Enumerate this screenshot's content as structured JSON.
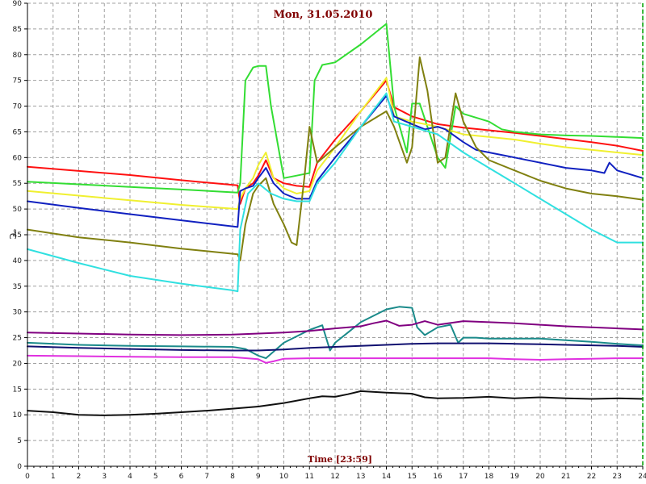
{
  "chart_data": {
    "type": "line",
    "title": "Mon, 31.05.2010",
    "xlabel": "Time [23:59]",
    "ylabel": "°C",
    "xlim": [
      0,
      24
    ],
    "ylim": [
      0,
      90
    ],
    "x_ticks": [
      0,
      1,
      2,
      3,
      4,
      5,
      6,
      7,
      8,
      9,
      10,
      11,
      12,
      13,
      14,
      15,
      16,
      17,
      18,
      19,
      20,
      21,
      22,
      23,
      24
    ],
    "y_ticks": [
      0,
      5,
      10,
      15,
      20,
      25,
      30,
      35,
      40,
      45,
      50,
      55,
      60,
      65,
      70,
      75,
      80,
      85,
      90
    ],
    "grid": true,
    "colors": {
      "grid": "#a0a0a0",
      "title": "#800000",
      "axis_frame_right": "#00a000"
    },
    "series": [
      {
        "color": "#ff1010",
        "x": [
          0,
          2,
          4,
          6,
          8.2,
          8.3,
          8.5,
          8.8,
          9,
          9.3,
          9.6,
          10,
          10.5,
          11,
          11.3,
          12,
          13,
          14,
          14.3,
          15,
          16,
          17,
          18,
          19,
          20,
          21,
          22,
          23,
          24
        ],
        "y": [
          58.2,
          57.4,
          56.6,
          55.6,
          54.6,
          51,
          54,
          55,
          56.5,
          59.5,
          56,
          55,
          54.5,
          54.3,
          59,
          63.5,
          69,
          75,
          69.8,
          68,
          66.5,
          65.8,
          65.3,
          64.8,
          64.2,
          63.6,
          63,
          62.3,
          61.3
        ]
      },
      {
        "color": "#33dd33",
        "x": [
          0,
          2,
          4,
          6,
          8.2,
          8.3,
          8.5,
          8.8,
          9,
          9.3,
          9.5,
          10,
          10.5,
          11,
          11.2,
          11.5,
          12,
          13,
          14,
          14.3,
          14.8,
          15,
          15.3,
          15.6,
          16,
          16.3,
          16.7,
          17,
          18,
          18.5,
          19,
          20,
          21,
          22,
          23,
          24
        ],
        "y": [
          55.3,
          54.8,
          54.3,
          53.8,
          53.2,
          55,
          75,
          77.5,
          77.8,
          77.8,
          70,
          56,
          56.5,
          57,
          75,
          78,
          78.5,
          82,
          86,
          70,
          61,
          70.5,
          70.5,
          66,
          60,
          58,
          70,
          68.5,
          67,
          65.5,
          65,
          64.5,
          64.3,
          64.2,
          64,
          63.8
        ]
      },
      {
        "color": "#f0f030",
        "x": [
          0,
          2,
          4,
          6,
          8.2,
          8.3,
          8.5,
          8.8,
          9,
          9.3,
          9.6,
          10,
          10.5,
          11,
          11.3,
          12,
          13,
          14,
          14.3,
          15,
          16,
          17,
          18,
          19,
          20,
          21,
          22,
          23,
          24
        ],
        "y": [
          53.5,
          52.6,
          51.7,
          50.8,
          50,
          52,
          54,
          56,
          58.5,
          61,
          56,
          54,
          53,
          53.5,
          57.5,
          62,
          69,
          75.5,
          68,
          67,
          66,
          64.5,
          64,
          63.5,
          62.7,
          62,
          61.5,
          61,
          60.5
        ]
      },
      {
        "color": "#1020c0",
        "x": [
          0,
          2,
          4,
          6,
          8.2,
          8.3,
          8.5,
          8.8,
          9,
          9.3,
          9.6,
          10,
          10.5,
          11,
          11.3,
          12,
          13,
          14,
          14.3,
          15,
          15.5,
          16,
          16.3,
          17,
          17.5,
          18,
          19,
          20,
          21,
          22,
          22.5,
          22.7,
          23,
          24
        ],
        "y": [
          51.5,
          50.2,
          49,
          47.8,
          46.5,
          53.5,
          54,
          54.5,
          56,
          58,
          55,
          53,
          52,
          52,
          55.5,
          60,
          66,
          72,
          68,
          66.5,
          65.5,
          66,
          65.5,
          63,
          61.5,
          61,
          60,
          59,
          58,
          57.5,
          57,
          59,
          57.5,
          56
        ]
      },
      {
        "color": "#808010",
        "x": [
          0,
          2,
          4,
          6,
          8.2,
          8.3,
          8.5,
          8.8,
          9,
          9.3,
          9.6,
          10,
          10.3,
          10.5,
          10.8,
          11,
          11.3,
          12,
          13,
          14,
          14.3,
          14.8,
          15,
          15.3,
          15.6,
          16,
          16.3,
          16.7,
          17,
          17.5,
          18,
          19,
          20,
          21,
          22,
          23,
          24
        ],
        "y": [
          46,
          44.5,
          43.5,
          42.3,
          41.2,
          40,
          47,
          53,
          54.5,
          56,
          51,
          47,
          43.5,
          43,
          56,
          66,
          59,
          62,
          66,
          69,
          66,
          59,
          62,
          79.5,
          73,
          59,
          60,
          72.5,
          67,
          62,
          59.5,
          57.5,
          55.5,
          54,
          53,
          52.5,
          51.8
        ]
      },
      {
        "color": "#30e0e0",
        "x": [
          0,
          2,
          4,
          6,
          8,
          8.2,
          8.3,
          8.6,
          9,
          9.5,
          10,
          10.5,
          11,
          11.3,
          12,
          13,
          14,
          14.3,
          15,
          16,
          17,
          18,
          19,
          20,
          21,
          22,
          23,
          24
        ],
        "y": [
          42.2,
          39.5,
          37,
          35.5,
          34.2,
          34,
          46,
          53,
          55,
          53,
          52,
          51.5,
          51.5,
          55,
          59,
          66,
          72.5,
          67,
          66,
          64.5,
          61,
          58,
          55,
          52,
          49,
          46,
          43.5,
          43.5
        ]
      },
      {
        "color": "#1a8a8a",
        "x": [
          0,
          2,
          4,
          6,
          8,
          8.5,
          9,
          9.3,
          10,
          11,
          11.5,
          11.8,
          12,
          12.5,
          13,
          14,
          14.5,
          15,
          15.2,
          15.5,
          16,
          16.5,
          16.8,
          17,
          17.5,
          18,
          19,
          20,
          21,
          22,
          23,
          24
        ],
        "y": [
          24,
          23.6,
          23.4,
          23.3,
          23.2,
          22.8,
          21.5,
          21,
          24,
          26.5,
          27.4,
          22.5,
          24,
          26,
          28,
          30.5,
          31,
          30.8,
          27,
          25.5,
          27,
          27.5,
          24,
          25,
          25,
          24.8,
          24.8,
          24.8,
          24.5,
          24.2,
          23.8,
          23.5
        ]
      },
      {
        "color": "#800080",
        "x": [
          0,
          2,
          4,
          6,
          8,
          9,
          10,
          11,
          12,
          13,
          13.5,
          14,
          14.5,
          15,
          15.5,
          16,
          17,
          18,
          19,
          20,
          21,
          22,
          23,
          24
        ],
        "y": [
          26,
          25.8,
          25.6,
          25.5,
          25.6,
          25.8,
          26,
          26.3,
          26.8,
          27.2,
          27.8,
          28.3,
          27.3,
          27.5,
          28.2,
          27.5,
          28.2,
          28,
          27.8,
          27.5,
          27.2,
          27,
          26.8,
          26.6
        ]
      },
      {
        "color": "#101070",
        "x": [
          0,
          2,
          4,
          6,
          8,
          9,
          10,
          11,
          12,
          13,
          14,
          15,
          16,
          17,
          18,
          19,
          20,
          21,
          22,
          23,
          24
        ],
        "y": [
          23.3,
          23,
          22.8,
          22.6,
          22.5,
          22.5,
          22.7,
          23,
          23.2,
          23.4,
          23.6,
          23.8,
          23.9,
          23.9,
          23.9,
          23.8,
          23.7,
          23.6,
          23.5,
          23.4,
          23.2
        ]
      },
      {
        "color": "#e030e0",
        "x": [
          0,
          2,
          4,
          6,
          8,
          9,
          9.3,
          9.6,
          10,
          11,
          12,
          13,
          14,
          15,
          16,
          17,
          18,
          19,
          20,
          21,
          22,
          23,
          24
        ],
        "y": [
          21.5,
          21.4,
          21.3,
          21.2,
          21.2,
          20.8,
          20.1,
          20.4,
          20.9,
          21,
          21,
          21,
          21,
          21,
          21,
          21,
          21,
          20.8,
          20.7,
          20.8,
          20.9,
          21,
          21
        ]
      },
      {
        "color": "#101010",
        "x": [
          0,
          1,
          2,
          3,
          4,
          5,
          6,
          7,
          8,
          9,
          10,
          11,
          11.5,
          12,
          12.5,
          13,
          14,
          15,
          15.5,
          16,
          17,
          18,
          19,
          20,
          21,
          22,
          23,
          24
        ],
        "y": [
          10.8,
          10.5,
          10,
          9.9,
          10,
          10.2,
          10.5,
          10.8,
          11.2,
          11.6,
          12.3,
          13.2,
          13.6,
          13.5,
          14,
          14.6,
          14.3,
          14.1,
          13.4,
          13.2,
          13.3,
          13.5,
          13.2,
          13.4,
          13.2,
          13.1,
          13.2,
          13.1
        ]
      }
    ]
  }
}
